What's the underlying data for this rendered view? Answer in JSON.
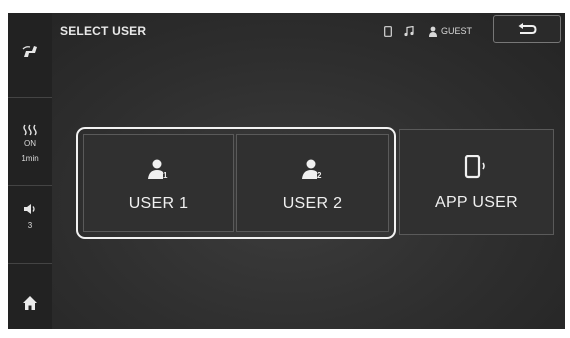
{
  "header": {
    "title": "SELECT USER"
  },
  "status": {
    "user_name": "GUEST"
  },
  "sidebar": {
    "fan_state": "ON",
    "fan_timer": "1min",
    "volume_level": "3"
  },
  "users": [
    {
      "label": "USER 1",
      "badge": "1"
    },
    {
      "label": "USER 2",
      "badge": "2"
    },
    {
      "label": "APP USER"
    }
  ],
  "colors": {
    "background": "#2f2f2f",
    "sidebar": "#222222",
    "highlight": "#f2f2f2",
    "text": "#f0f0f0"
  }
}
